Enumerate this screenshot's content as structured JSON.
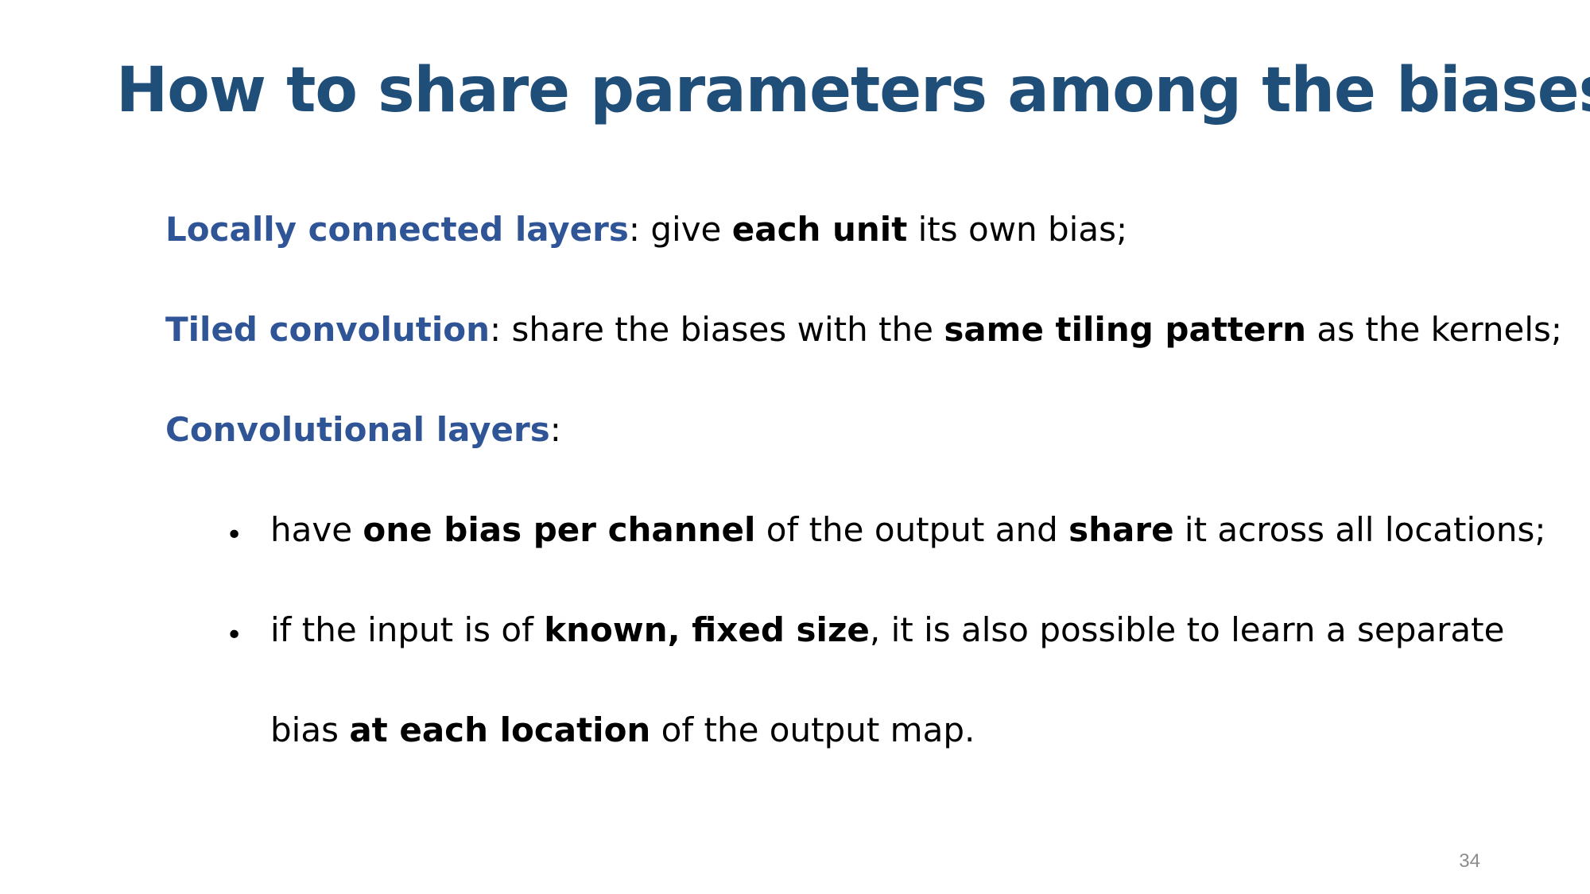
{
  "slide": {
    "title": "How to share parameters among the biases",
    "page_number": "34",
    "colors": {
      "title": "#1f4e79",
      "term": "#2f5597",
      "text": "#000000",
      "page_number": "#8c8c8c"
    },
    "items": [
      {
        "term": "Locally connected layers",
        "p1": ": give ",
        "bold1": "each unit",
        "p2": " its own bias;"
      },
      {
        "term": "Tiled convolution",
        "p1": ": share the biases with the ",
        "bold1": "same tiling pattern",
        "p2": " as the kernels;"
      },
      {
        "term": "Convolutional layers",
        "p1": ":"
      }
    ],
    "bullets": [
      {
        "p1": "have ",
        "bold1": "one bias per channel",
        "p2": " of the output and ",
        "bold2": "share",
        "p3": " it across all locations;"
      },
      {
        "p1": "if the input is of ",
        "bold1": "known, fixed size",
        "p2": ", it is also possible to learn a separate",
        "cont_p1": "bias ",
        "cont_bold1": "at each location",
        "cont_p2": " of the output map."
      }
    ],
    "bullet_symbol": "•"
  }
}
